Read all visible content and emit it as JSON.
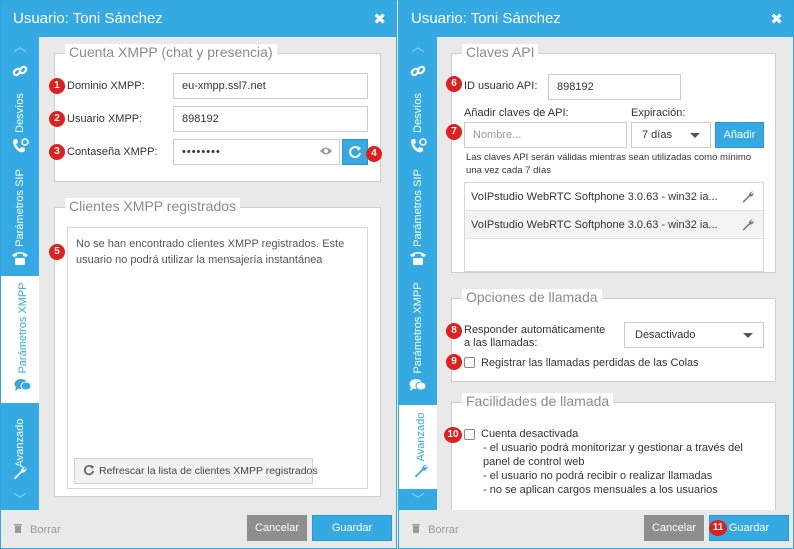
{
  "left": {
    "title": "Usuario: Toni Sánchez",
    "nav": {
      "desvios": "Desvíos",
      "sip": "Parámetros SIP",
      "xmpp": "Parámetros XMPP",
      "avanzado": "Avanzado"
    },
    "account_panel": {
      "title": "Cuenta XMPP (chat y presencia)",
      "domain_label": "Dominio XMPP:",
      "domain_value": "eu-xmpp.ssl7.net",
      "user_label": "Usuario XMPP:",
      "user_value": "898192",
      "password_label": "Contaseña XMPP:",
      "password_value": "••••••••"
    },
    "clients_panel": {
      "title": "Clientes XMPP registrados",
      "empty_message": "No se han encontrado clientes XMPP registrados. Este usuario no podrá utilizar la mensajería instantánea",
      "refresh_label": "Refrescar la lista de clientes XMPP registrados"
    },
    "footer": {
      "delete": "Borrar",
      "cancel": "Cancelar",
      "save": "Guardar"
    },
    "badges": [
      "1",
      "2",
      "3",
      "4",
      "5"
    ]
  },
  "right": {
    "title": "Usuario: Toni Sánchez",
    "nav": {
      "desvios": "Desvíos",
      "sip": "Parámetros SIP",
      "xmpp": "Parámetros XMPP",
      "avanzado": "Avanzado"
    },
    "api_panel": {
      "title": "Claves API",
      "id_label": "ID usuario API:",
      "id_value": "898192",
      "add_label": "Añadir claves de API:",
      "expiry_label": "Expiración:",
      "name_placeholder": "Nombre...",
      "expiry_value": "7 días",
      "add_button": "Añadir",
      "note": "Las claves API serán válidas mientras sean utilizadas como mínimo una vez cada 7 días",
      "keys": [
        "VoIPstudio WebRTC Softphone 3.0.63 - win32 ia...",
        "VoIPstudio WebRTC Softphone 3.0.63 - win32 ia..."
      ]
    },
    "call_options": {
      "title": "Opciones de llamada",
      "autoanswer_label": "Responder automáticamente a las llamadas:",
      "autoanswer_value": "Desactivado",
      "missed_label": "Registrar las llamadas perdidas de las Colas"
    },
    "facilities": {
      "title": "Facilidades de llamada",
      "disabled_label": "Cuenta desactivada",
      "lines": [
        "- el usuario podrá monitorizar y gestionar a través del",
        "panel de control web",
        "- el usuario no podrá recibir o realizar llamadas",
        "- no se aplican cargos mensuales a los usuarios"
      ]
    },
    "footer": {
      "delete": "Borrar",
      "cancel": "Cancelar",
      "save": "Guardar"
    },
    "badges": [
      "6",
      "7",
      "8",
      "9",
      "10",
      "11"
    ]
  },
  "colors": {
    "accent": "#35a9e1",
    "badge": "#e01f1f",
    "panel_bg": "#e9e9e9"
  }
}
